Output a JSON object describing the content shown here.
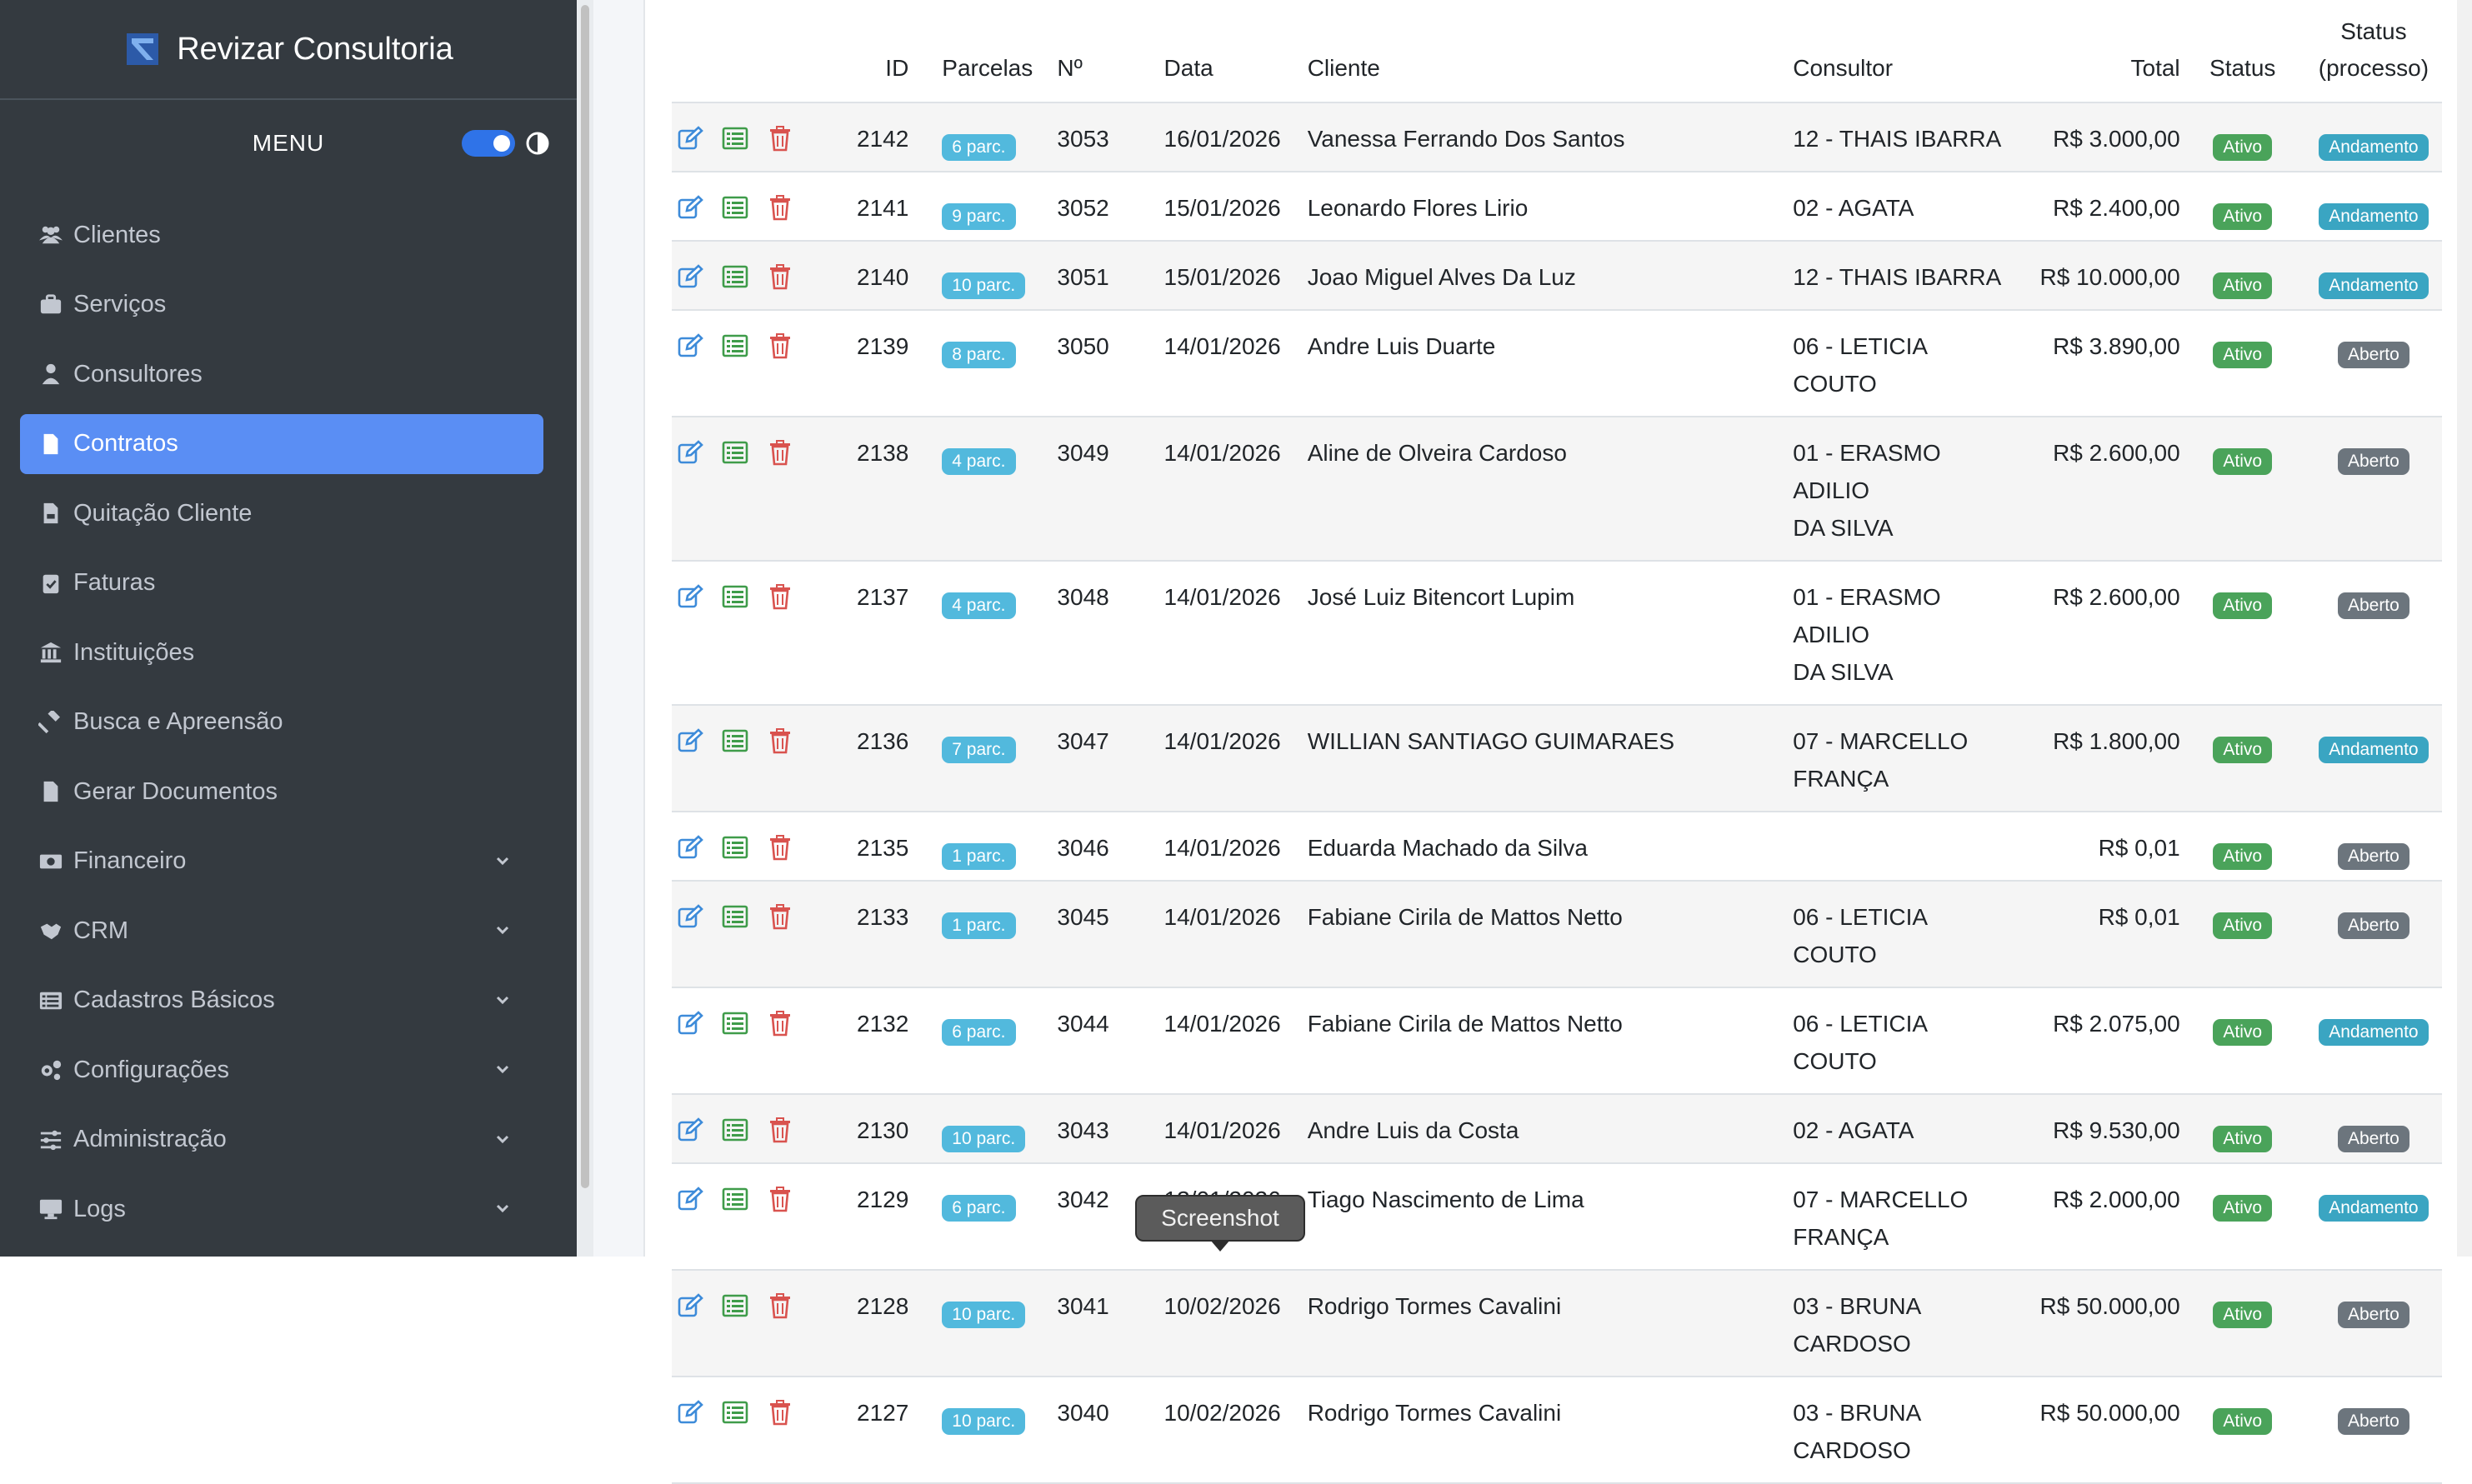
{
  "brand": {
    "title": "Revizar Consultoria"
  },
  "menu_header": "MENU",
  "sidebar": {
    "items": [
      {
        "label": "Clientes",
        "icon": "users-icon",
        "active": false,
        "expandable": false
      },
      {
        "label": "Serviços",
        "icon": "briefcase-icon",
        "active": false,
        "expandable": false
      },
      {
        "label": "Consultores",
        "icon": "user-tie-icon",
        "active": false,
        "expandable": false
      },
      {
        "label": "Contratos",
        "icon": "file-icon",
        "active": true,
        "expandable": false
      },
      {
        "label": "Quitação Cliente",
        "icon": "file-invoice-icon",
        "active": false,
        "expandable": false
      },
      {
        "label": "Faturas",
        "icon": "clipboard-check-icon",
        "active": false,
        "expandable": false
      },
      {
        "label": "Instituições",
        "icon": "bank-icon",
        "active": false,
        "expandable": false
      },
      {
        "label": "Busca e Apreensão",
        "icon": "gavel-icon",
        "active": false,
        "expandable": false
      },
      {
        "label": "Gerar Documentos",
        "icon": "file-pdf-icon",
        "active": false,
        "expandable": false
      },
      {
        "label": "Financeiro",
        "icon": "money-icon",
        "active": false,
        "expandable": true
      },
      {
        "label": "CRM",
        "icon": "handshake-icon",
        "active": false,
        "expandable": true
      },
      {
        "label": "Cadastros Básicos",
        "icon": "list-icon",
        "active": false,
        "expandable": true
      },
      {
        "label": "Configurações",
        "icon": "cogs-icon",
        "active": false,
        "expandable": true
      },
      {
        "label": "Administração",
        "icon": "sliders-icon",
        "active": false,
        "expandable": true
      },
      {
        "label": "Logs",
        "icon": "desktop-icon",
        "active": false,
        "expandable": true
      }
    ]
  },
  "table": {
    "headers": {
      "id": "ID",
      "parcelas": "Parcelas",
      "numero": "Nº",
      "data": "Data",
      "cliente": "Cliente",
      "consultor": "Consultor",
      "total": "Total",
      "status": "Status",
      "status_processo_1": "Status",
      "status_processo_2": "(processo)"
    },
    "rows": [
      {
        "id": "2142",
        "parcelas": "6 parc.",
        "numero": "3053",
        "data": "16/01/2026",
        "cliente": "Vanessa Ferrando Dos Santos",
        "consultor": [
          "12 - THAIS IBARRA"
        ],
        "total": "R$ 3.000,00",
        "status": "Ativo",
        "processo": "Andamento"
      },
      {
        "id": "2141",
        "parcelas": "9 parc.",
        "numero": "3052",
        "data": "15/01/2026",
        "cliente": "Leonardo Flores Lirio",
        "consultor": [
          "02 - AGATA"
        ],
        "total": "R$ 2.400,00",
        "status": "Ativo",
        "processo": "Andamento"
      },
      {
        "id": "2140",
        "parcelas": "10 parc.",
        "numero": "3051",
        "data": "15/01/2026",
        "cliente": "Joao Miguel Alves Da Luz",
        "consultor": [
          "12 - THAIS IBARRA"
        ],
        "total": "R$ 10.000,00",
        "status": "Ativo",
        "processo": "Andamento"
      },
      {
        "id": "2139",
        "parcelas": "8 parc.",
        "numero": "3050",
        "data": "14/01/2026",
        "cliente": "Andre Luis Duarte",
        "consultor": [
          "06 - LETICIA COUTO"
        ],
        "total": "R$ 3.890,00",
        "status": "Ativo",
        "processo": "Aberto"
      },
      {
        "id": "2138",
        "parcelas": "4 parc.",
        "numero": "3049",
        "data": "14/01/2026",
        "cliente": "Aline de Olveira Cardoso",
        "consultor": [
          "01 - ERASMO ADILIO",
          "DA SILVA"
        ],
        "total": "R$ 2.600,00",
        "status": "Ativo",
        "processo": "Aberto"
      },
      {
        "id": "2137",
        "parcelas": "4 parc.",
        "numero": "3048",
        "data": "14/01/2026",
        "cliente": "José Luiz Bitencort Lupim",
        "consultor": [
          "01 - ERASMO ADILIO",
          "DA SILVA"
        ],
        "total": "R$ 2.600,00",
        "status": "Ativo",
        "processo": "Aberto"
      },
      {
        "id": "2136",
        "parcelas": "7 parc.",
        "numero": "3047",
        "data": "14/01/2026",
        "cliente": "WILLIAN SANTIAGO GUIMARAES",
        "consultor": [
          "07 - MARCELLO",
          "FRANÇA"
        ],
        "total": "R$ 1.800,00",
        "status": "Ativo",
        "processo": "Andamento"
      },
      {
        "id": "2135",
        "parcelas": "1 parc.",
        "numero": "3046",
        "data": "14/01/2026",
        "cliente": "Eduarda Machado da Silva",
        "consultor": [
          ""
        ],
        "total": "R$ 0,01",
        "status": "Ativo",
        "processo": "Aberto"
      },
      {
        "id": "2133",
        "parcelas": "1 parc.",
        "numero": "3045",
        "data": "14/01/2026",
        "cliente": "Fabiane Cirila de Mattos Netto",
        "consultor": [
          "06 - LETICIA COUTO"
        ],
        "total": "R$ 0,01",
        "status": "Ativo",
        "processo": "Aberto"
      },
      {
        "id": "2132",
        "parcelas": "6 parc.",
        "numero": "3044",
        "data": "14/01/2026",
        "cliente": "Fabiane Cirila de Mattos Netto",
        "consultor": [
          "06 - LETICIA COUTO"
        ],
        "total": "R$ 2.075,00",
        "status": "Ativo",
        "processo": "Andamento"
      },
      {
        "id": "2130",
        "parcelas": "10 parc.",
        "numero": "3043",
        "data": "14/01/2026",
        "cliente": "Andre Luis da Costa",
        "consultor": [
          "02 - AGATA"
        ],
        "total": "R$ 9.530,00",
        "status": "Ativo",
        "processo": "Aberto"
      },
      {
        "id": "2129",
        "parcelas": "6 parc.",
        "numero": "3042",
        "data": "13/01/2026",
        "cliente": "Tiago Nascimento de Lima",
        "consultor": [
          "07 - MARCELLO",
          "FRANÇA"
        ],
        "total": "R$ 2.000,00",
        "status": "Ativo",
        "processo": "Andamento"
      },
      {
        "id": "2128",
        "parcelas": "10 parc.",
        "numero": "3041",
        "data": "10/02/2026",
        "cliente": "Rodrigo Tormes Cavalini",
        "consultor": [
          "03 - BRUNA",
          "CARDOSO"
        ],
        "total": "R$ 50.000,00",
        "status": "Ativo",
        "processo": "Aberto"
      },
      {
        "id": "2127",
        "parcelas": "10 parc.",
        "numero": "3040",
        "data": "10/02/2026",
        "cliente": "Rodrigo Tormes Cavalini",
        "consultor": [
          "03 - BRUNA",
          "CARDOSO"
        ],
        "total": "R$ 50.000,00",
        "status": "Ativo",
        "processo": "Aberto"
      }
    ]
  },
  "tooltip": {
    "text": "Screenshot"
  },
  "colors": {
    "sidebar_bg": "#343a40",
    "active_item": "#5a8ef4",
    "badge_parcelas": "#52b9dd",
    "badge_ativo": "#4aa35a",
    "badge_andamento": "#3aa5c2",
    "badge_aberto": "#6c757d",
    "icon_edit": "#3d8bd9",
    "icon_list": "#3f9c4a",
    "icon_delete": "#d9534f"
  }
}
